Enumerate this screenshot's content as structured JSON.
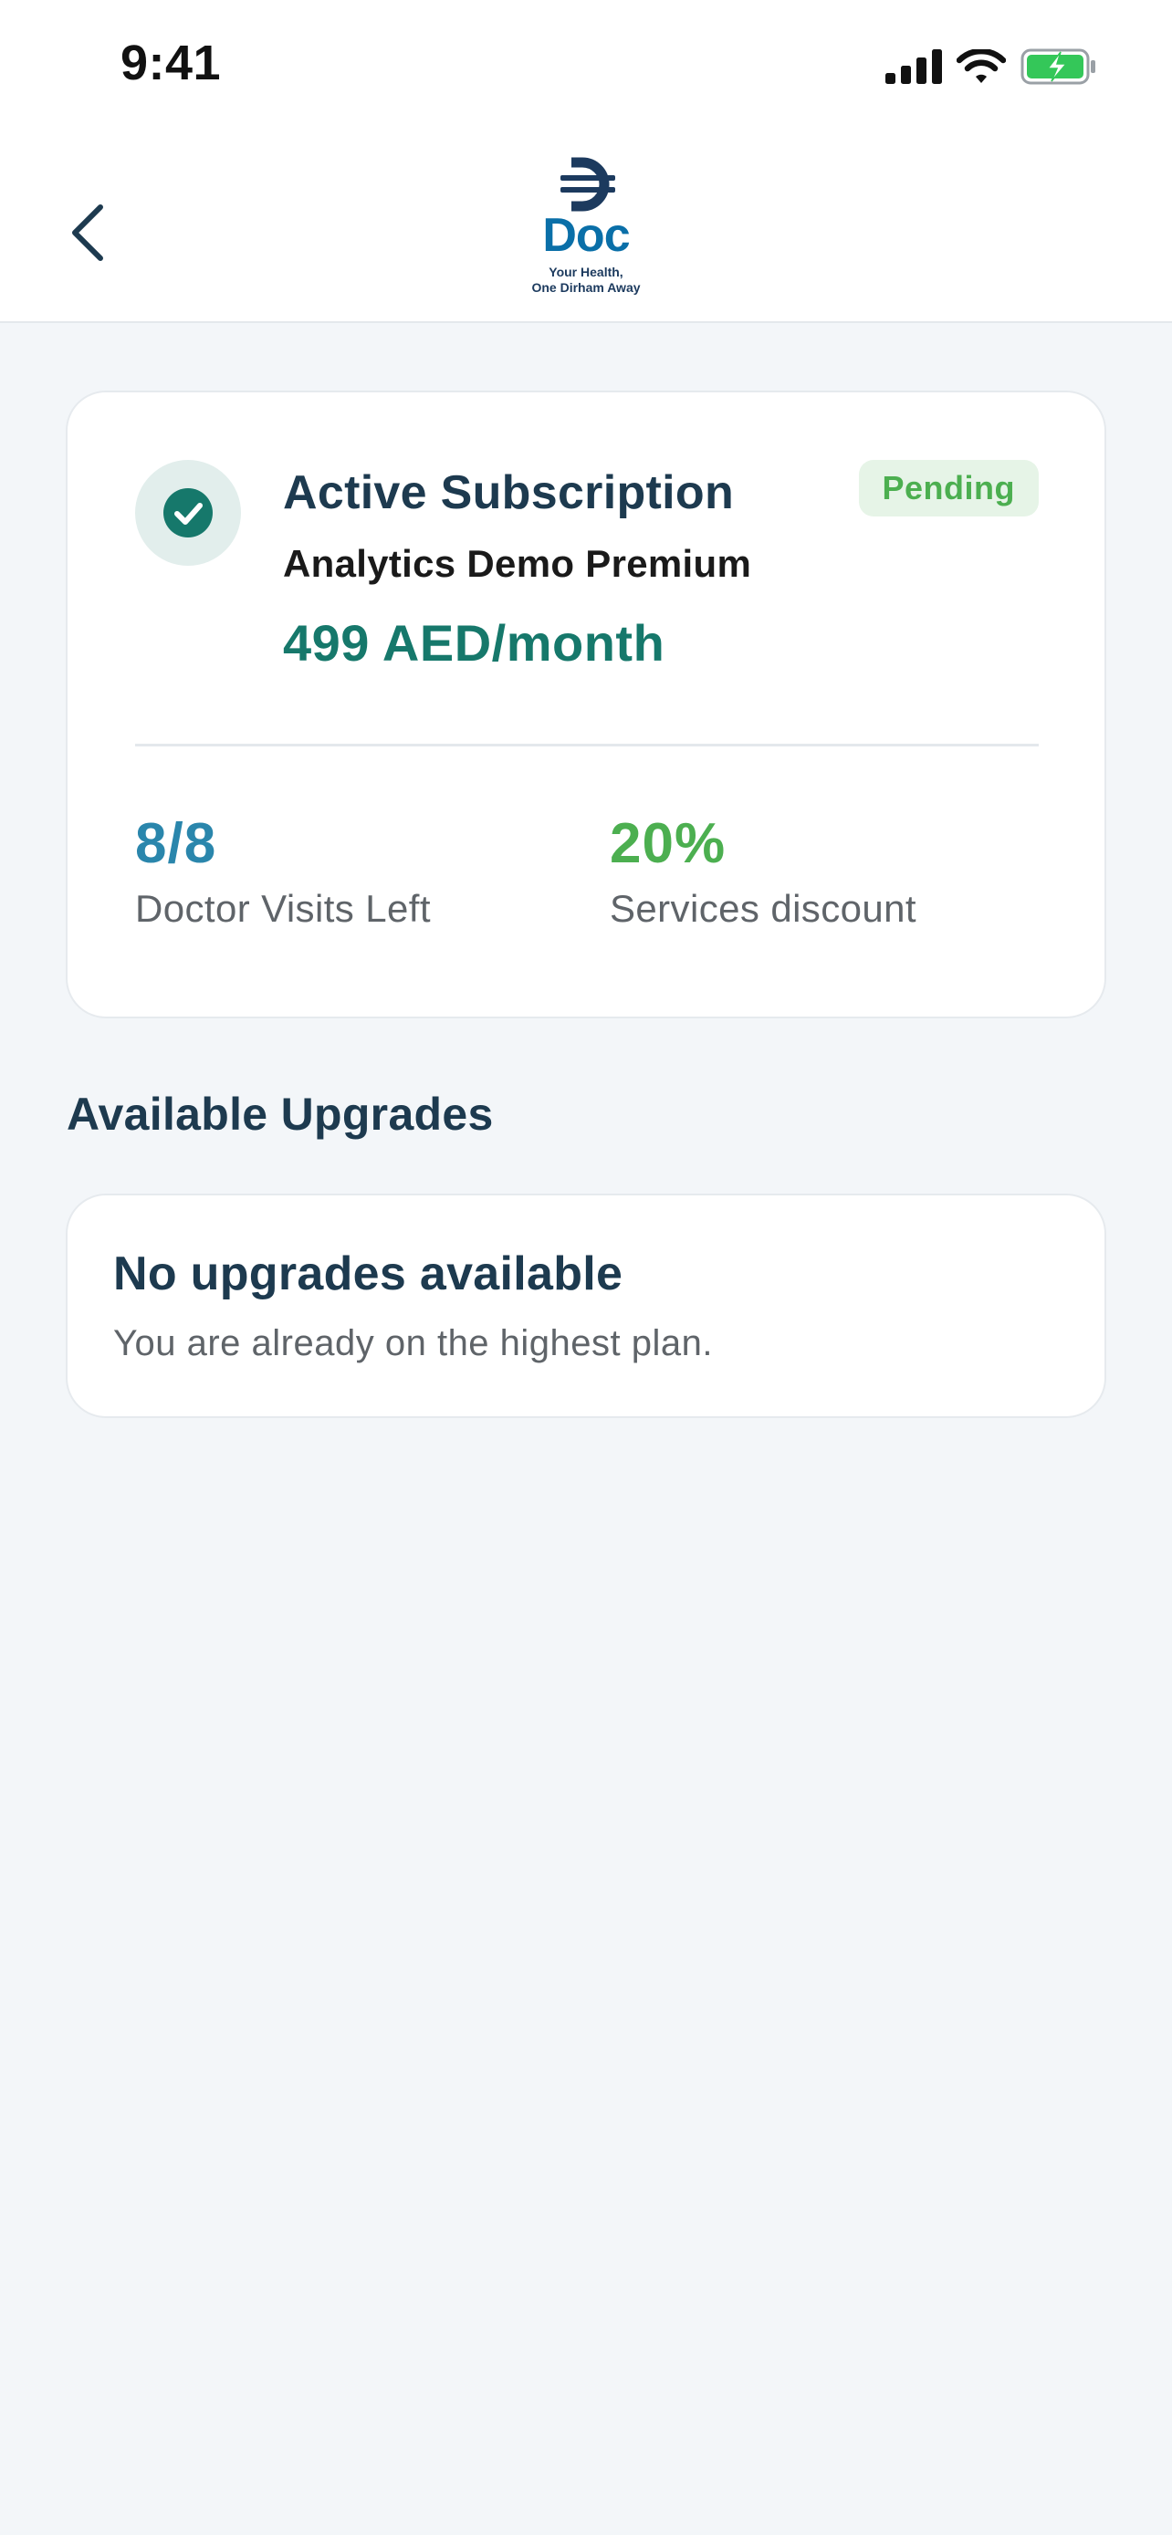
{
  "status_bar": {
    "time": "9:41",
    "icons": [
      "signal-icon",
      "wifi-icon",
      "battery-charging-icon"
    ]
  },
  "nav": {
    "back_icon": "chevron-left-icon",
    "logo_text": "Doc",
    "logo_tagline_line1": "Your Health,",
    "logo_tagline_line2": "One Dirham Away"
  },
  "subscription": {
    "title": "Active Subscription",
    "status": "Pending",
    "plan_name": "Analytics Demo Premium",
    "price": "499 AED/month",
    "stats": {
      "visits_value": "8/8",
      "visits_label": "Doctor Visits Left",
      "discount_value": "20%",
      "discount_label": "Services discount"
    }
  },
  "upgrades": {
    "heading": "Available Upgrades",
    "empty_title": "No upgrades available",
    "empty_text": "You are already on the highest plan."
  },
  "colors": {
    "accent_teal": "#16786b",
    "visits_blue": "#2a86ac",
    "discount_green": "#4caf50",
    "heading_navy": "#1d3a4f",
    "background": "#f3f6f9"
  }
}
